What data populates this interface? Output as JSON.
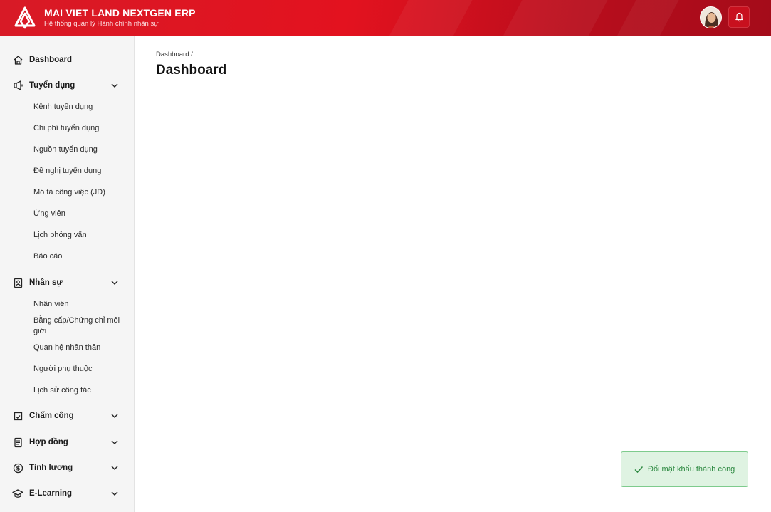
{
  "app": {
    "title": "MAI VIET LAND NEXTGEN ERP",
    "subtitle": "Hệ thống quản lý Hành chính nhân sự",
    "logo_icon": "triangle-logo",
    "brand_color": "#e3121f"
  },
  "header": {
    "avatar_icon": "user-avatar",
    "notification_icon": "bell-icon"
  },
  "sidebar": {
    "dashboard": {
      "label": "Dashboard",
      "icon": "home-icon"
    },
    "recruitment": {
      "label": "Tuyển dụng",
      "icon": "megaphone-icon",
      "expanded": true,
      "items": [
        "Kênh tuyển dụng",
        "Chi phí tuyển dụng",
        "Nguồn tuyển dụng",
        "Đề nghị tuyển dụng",
        "Mô tả công việc (JD)",
        "Ứng viên",
        "Lịch phỏng vấn",
        "Báo cáo"
      ]
    },
    "hr": {
      "label": "Nhân sự",
      "icon": "contact-icon",
      "expanded": true,
      "items": [
        "Nhân viên",
        "Bằng cấp/Chứng chỉ môi giới",
        "Quan hệ nhân thân",
        "Người phụ thuộc",
        "Lịch sử công tác"
      ]
    },
    "attendance": {
      "label": "Chấm công",
      "icon": "calendar-check-icon"
    },
    "contracts": {
      "label": "Hợp đồng",
      "icon": "document-icon"
    },
    "payroll": {
      "label": "Tính lương",
      "icon": "dollar-icon"
    },
    "elearning": {
      "label": "E-Learning",
      "icon": "graduation-cap-icon"
    }
  },
  "main": {
    "breadcrumb": "Dashboard /",
    "title": "Dashboard"
  },
  "toast": {
    "message": "Đổi mật khẩu thành công",
    "icon": "check-icon",
    "color": "#2e8a42"
  }
}
